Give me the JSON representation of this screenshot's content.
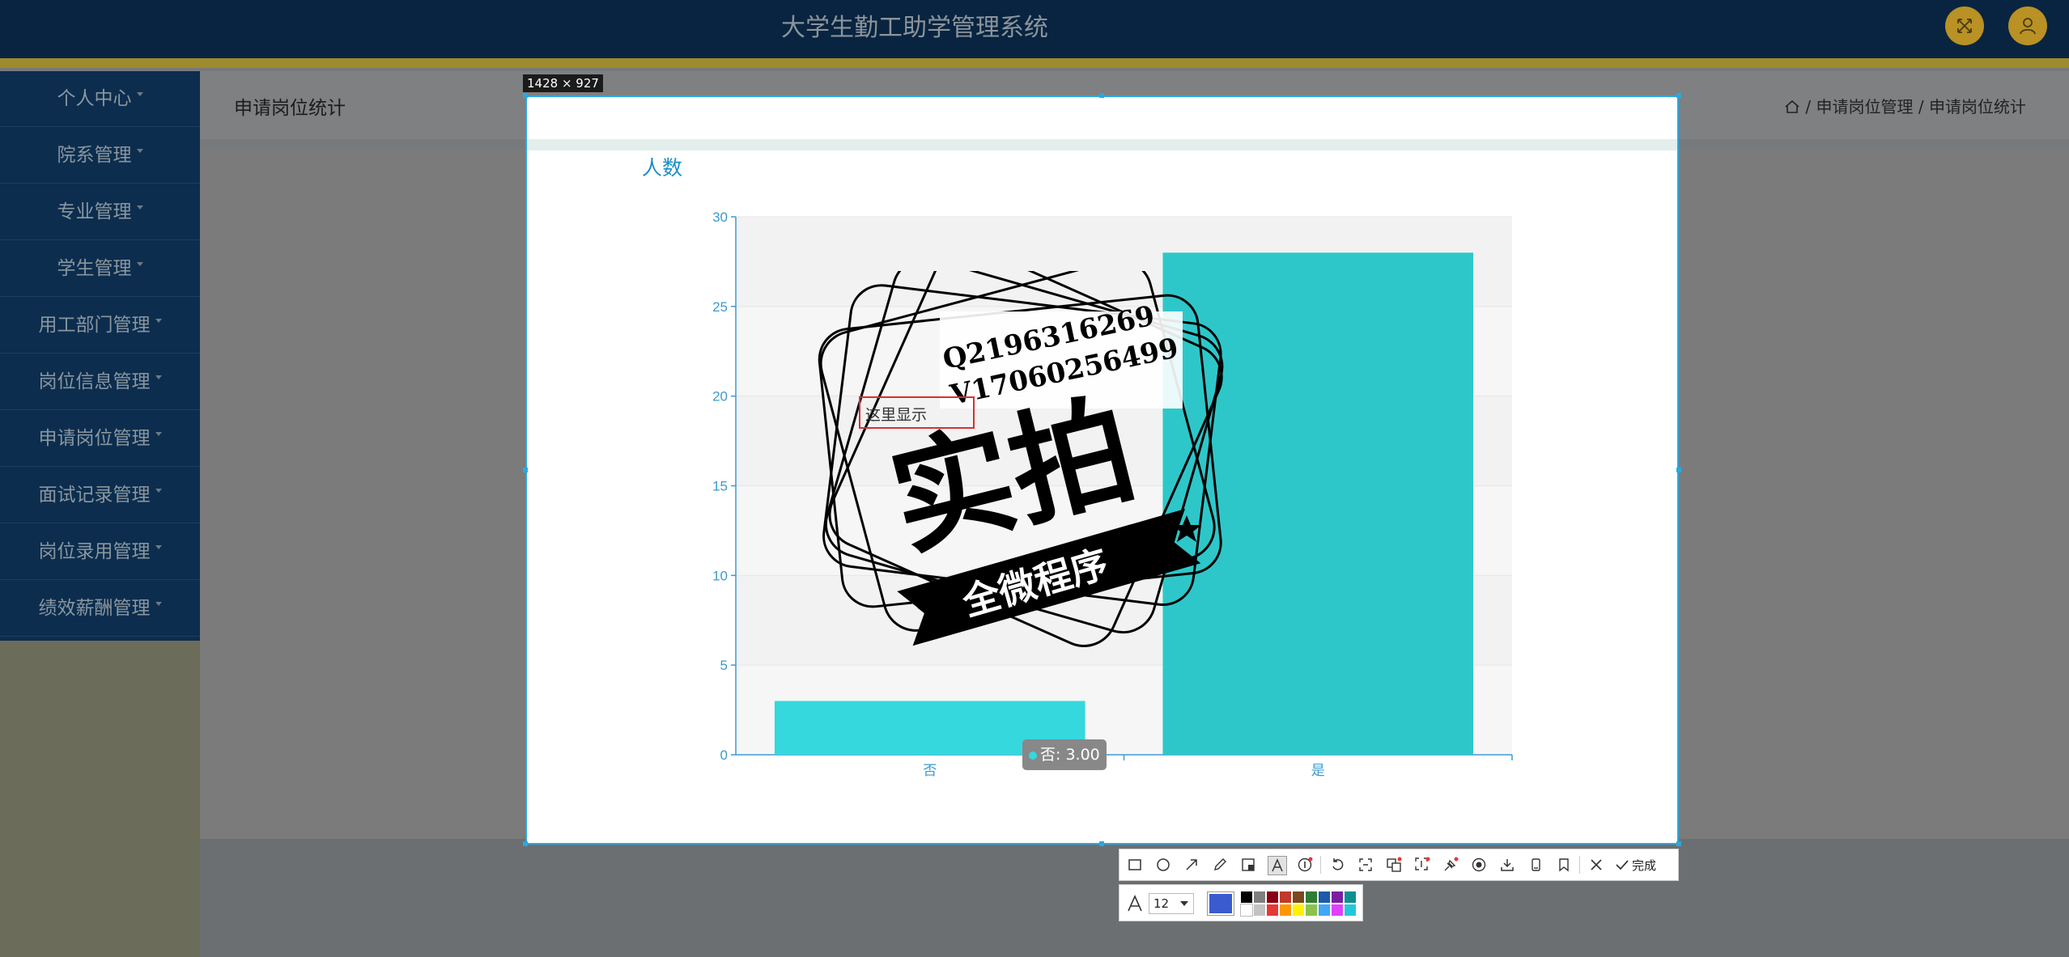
{
  "header": {
    "title": "大学生勤工助学管理系统"
  },
  "sidebar": {
    "items": [
      {
        "label": "个人中心"
      },
      {
        "label": "院系管理"
      },
      {
        "label": "专业管理"
      },
      {
        "label": "学生管理"
      },
      {
        "label": "用工部门管理"
      },
      {
        "label": "岗位信息管理"
      },
      {
        "label": "申请岗位管理"
      },
      {
        "label": "面试记录管理"
      },
      {
        "label": "岗位录用管理"
      },
      {
        "label": "绩效薪酬管理"
      }
    ]
  },
  "page": {
    "title": "申请岗位统计",
    "breadcrumb": [
      "申请岗位管理",
      "申请岗位统计"
    ],
    "breadcrumb_sep": "/"
  },
  "capture": {
    "size_label": "1428 × 927",
    "watermark": {
      "line1": "Q2196316269",
      "line2": "V17060256499",
      "big": "实拍",
      "banner": "全微程序",
      "note": "这里显示"
    },
    "tooltip": "否: 3.00"
  },
  "chart_data": {
    "type": "bar",
    "ylabel": "人数",
    "categories": [
      "否",
      "是"
    ],
    "values": [
      3,
      28
    ],
    "ylim": [
      0,
      30
    ],
    "yticks": [
      0,
      5,
      10,
      15,
      20,
      25,
      30
    ],
    "colors": [
      "#34d8dd",
      "#2ec7c9"
    ],
    "grid": true
  },
  "toolbar": {
    "icons": [
      "rect-icon",
      "ellipse-icon",
      "arrow-icon",
      "pen-icon",
      "mosaic-icon",
      "text-icon",
      "number-icon",
      "undo-icon",
      "ocr-icon",
      "translate-icon",
      "long-screenshot-icon",
      "pin-icon",
      "record-icon",
      "download-icon",
      "copy-icon",
      "save-icon",
      "cancel-icon"
    ],
    "done_label": "完成",
    "font_size": "12",
    "current_color": "#3a5bd0",
    "palette_top": [
      "#000000",
      "#7f7f7f",
      "#880015",
      "#c0392b",
      "#7a4a1e",
      "#2e7d32",
      "#1e5aa8",
      "#7b1fa2",
      "#0e8e8e"
    ],
    "palette_bottom": [
      "#ffffff",
      "#c3c3c3",
      "#e53935",
      "#ff9800",
      "#fff200",
      "#8bc34a",
      "#42a5f5",
      "#e040fb",
      "#26c6da"
    ]
  }
}
